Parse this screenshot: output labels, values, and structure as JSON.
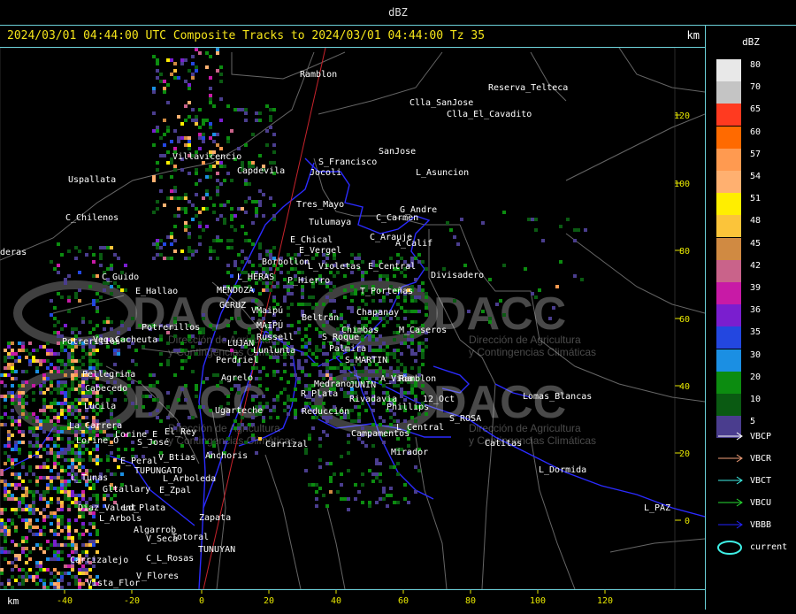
{
  "window_title": "dBZ",
  "header": {
    "title": "2024/03/01 04:44:00 UTC Composite Tracks to 2024/03/01 04:44:00 Tz 35",
    "unit": "km"
  },
  "x_axis": {
    "unit": "km",
    "ticks": [
      "-40",
      "-20",
      "0",
      "20",
      "40",
      "60",
      "80",
      "100",
      "120"
    ]
  },
  "y_axis": {
    "ticks": [
      "120",
      "100",
      "80",
      "60",
      "40",
      "20",
      "0"
    ]
  },
  "watermark": [
    "DACC",
    "Dirección de Agricultura",
    "y Contingencias Climáticas"
  ],
  "places": [
    "Ramblon",
    "Reserva_Telteca",
    "Clla_SanJose",
    "Clla_El_Cavadito",
    "SanJose",
    "Villavicencio",
    "Capdevila",
    "S_Francisco",
    "Jocoli",
    "L_Asuncion",
    "Uspallata",
    "Tres_Mayo",
    "G_Andre",
    "C_Carmen",
    "Tulumaya",
    "C_Chilenos",
    "E_Chical",
    "C_Arauje",
    "A_Calif",
    "E_Vergel",
    "deras",
    "Borbollon",
    "L_Violetas",
    "E_Central",
    "Divisadero",
    "C_Guido",
    "E_Hallao",
    "L_HERAS",
    "P_Hierro",
    "T_Porteñas",
    "MENDOZA",
    "GCRUZ",
    "Chapanay",
    "VMaipú",
    "Beltrán",
    "Vegas",
    "Potrerillos",
    "Cacheuta",
    "MAIPÚ",
    "Russell",
    "Chimbas",
    "M_Caseros",
    "LUJAN",
    "Lunlunta",
    "S_Roque",
    "Potrerillos",
    "Perdriel",
    "Palmira",
    "S_MARTIN",
    "Pellegrina",
    "Agrelo",
    "Cabecedo",
    "Medrano",
    "JUNIN",
    "A_Viña",
    "Ramblon",
    "Lucila",
    "R_Plata",
    "Rivadavia",
    "12_Oct",
    "Lomas_Blancas",
    "Phillips",
    "Ugarteche",
    "Reducción",
    "S_ROSA",
    "La_Carrera",
    "El_Rey",
    "Lorine_E",
    "Lorine_O",
    "S_José",
    "Carrizal",
    "Campamentos",
    "L_Central",
    "Catitas",
    "Anchoris",
    "E_Peral",
    "V_Btias",
    "Mirador",
    "L_Dormida",
    "TUPUNGATO",
    "L_Tunas",
    "L_Arboleda",
    "Gltallary",
    "E_Zpal",
    "Diaz_Valent",
    "Ld_Plata",
    "Zapata",
    "L_PAZ",
    "L_Arbols",
    "Algarrob",
    "V_Seca",
    "Totoral",
    "Carrizalejo",
    "C_L_Rosas",
    "TUNUYAN",
    "V_Flores",
    "Vista_Flor"
  ],
  "legend": {
    "title": "dBZ",
    "scale": [
      {
        "label": "80",
        "color": "#e8e8e8"
      },
      {
        "label": "70",
        "color": "#c4c4c4"
      },
      {
        "label": "65",
        "color": "#ff3a20"
      },
      {
        "label": "60",
        "color": "#ff6a00"
      },
      {
        "label": "57",
        "color": "#ff9a50"
      },
      {
        "label": "54",
        "color": "#ffb070"
      },
      {
        "label": "51",
        "color": "#ffee00"
      },
      {
        "label": "48",
        "color": "#fbc43a"
      },
      {
        "label": "45",
        "color": "#d08a42"
      },
      {
        "label": "42",
        "color": "#c9638a"
      },
      {
        "label": "39",
        "color": "#c81aa6"
      },
      {
        "label": "36",
        "color": "#7a1ecf"
      },
      {
        "label": "35",
        "color": "#2347e0"
      },
      {
        "label": "30",
        "color": "#1b8fe3"
      },
      {
        "label": "20",
        "color": "#0c8c10"
      },
      {
        "label": "10",
        "color": "#0a5a12"
      },
      {
        "label": "5",
        "color": "#4a3d8e"
      }
    ],
    "tracks": [
      {
        "label": "VBCP",
        "color": "#ffffff"
      },
      {
        "label": "VBCR",
        "color": "#f3a07a"
      },
      {
        "label": "VBCT",
        "color": "#3ff0e6"
      },
      {
        "label": "VBCU",
        "color": "#27dd33"
      },
      {
        "label": "VBBB",
        "color": "#2222ff"
      }
    ],
    "current_label": "current",
    "current_color": "#3ff0e6"
  }
}
